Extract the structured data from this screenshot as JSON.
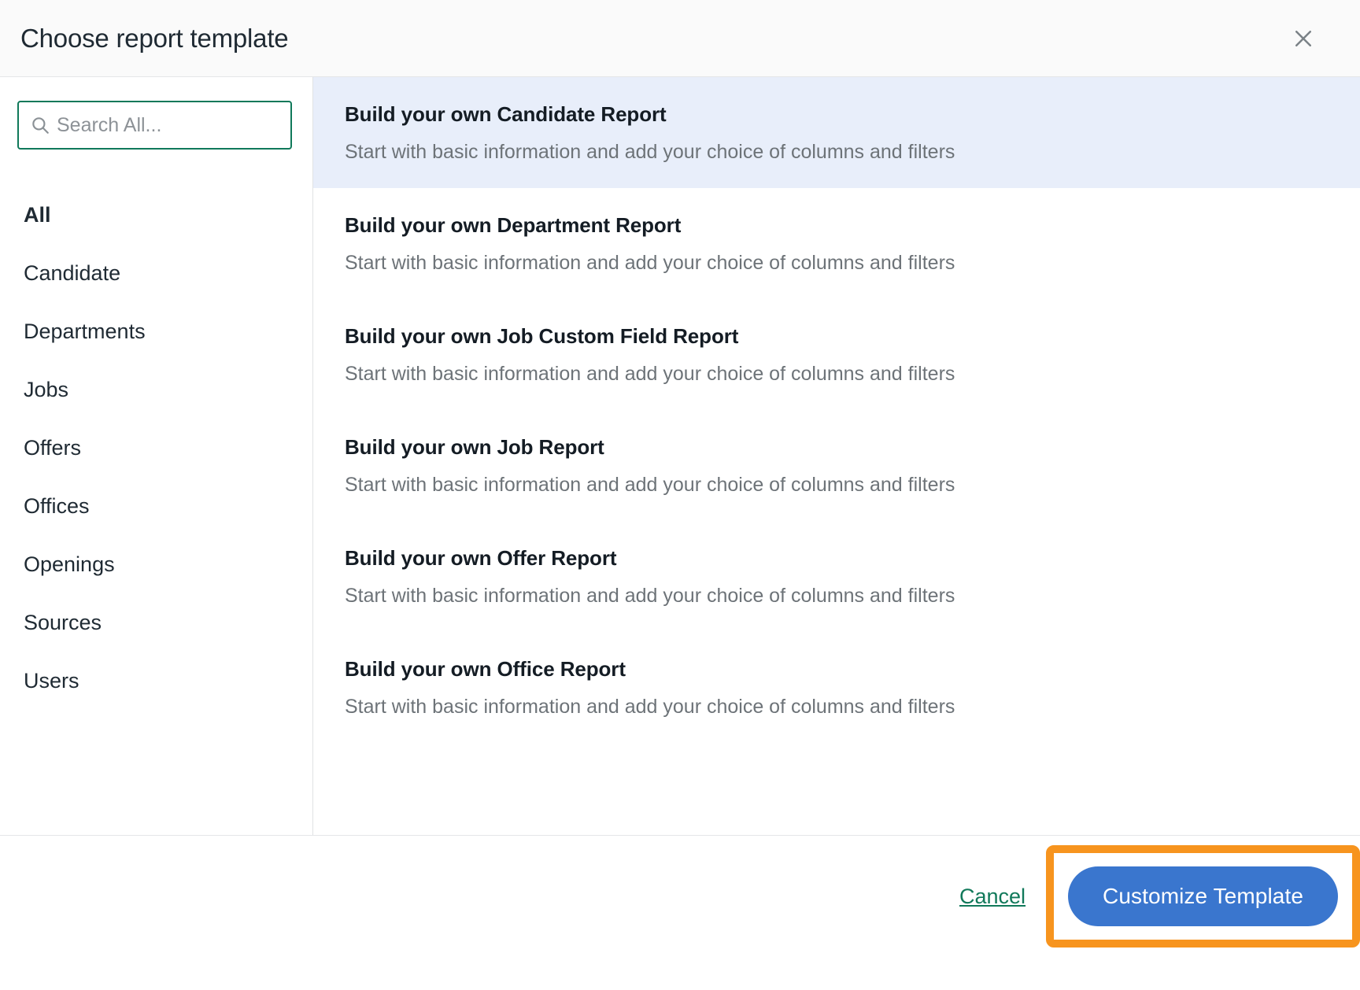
{
  "header": {
    "title": "Choose report template",
    "close_icon": "close-icon"
  },
  "sidebar": {
    "search": {
      "icon": "search-icon",
      "placeholder": "Search All...",
      "value": ""
    },
    "items": [
      {
        "label": "All",
        "selected": true
      },
      {
        "label": "Candidate",
        "selected": false
      },
      {
        "label": "Departments",
        "selected": false
      },
      {
        "label": "Jobs",
        "selected": false
      },
      {
        "label": "Offers",
        "selected": false
      },
      {
        "label": "Offices",
        "selected": false
      },
      {
        "label": "Openings",
        "selected": false
      },
      {
        "label": "Sources",
        "selected": false
      },
      {
        "label": "Users",
        "selected": false
      }
    ]
  },
  "templates": [
    {
      "title": "Build your own Candidate Report",
      "description": "Start with basic information and add your choice of columns and filters",
      "selected": true
    },
    {
      "title": "Build your own Department Report",
      "description": "Start with basic information and add your choice of columns and filters",
      "selected": false
    },
    {
      "title": "Build your own Job Custom Field Report",
      "description": "Start with basic information and add your choice of columns and filters",
      "selected": false
    },
    {
      "title": "Build your own Job Report",
      "description": "Start with basic information and add your choice of columns and filters",
      "selected": false
    },
    {
      "title": "Build your own Offer Report",
      "description": "Start with basic information and add your choice of columns and filters",
      "selected": false
    },
    {
      "title": "Build your own Office Report",
      "description": "Start with basic information and add your choice of columns and filters",
      "selected": false
    }
  ],
  "footer": {
    "cancel_label": "Cancel",
    "primary_label": "Customize Template"
  },
  "colors": {
    "selected_row": "#e8eefa",
    "primary_button": "#3a76ce",
    "link_green": "#11795a",
    "search_border_green": "#10795a",
    "highlight_orange": "#f7941e",
    "header_background": "#fafafa"
  }
}
